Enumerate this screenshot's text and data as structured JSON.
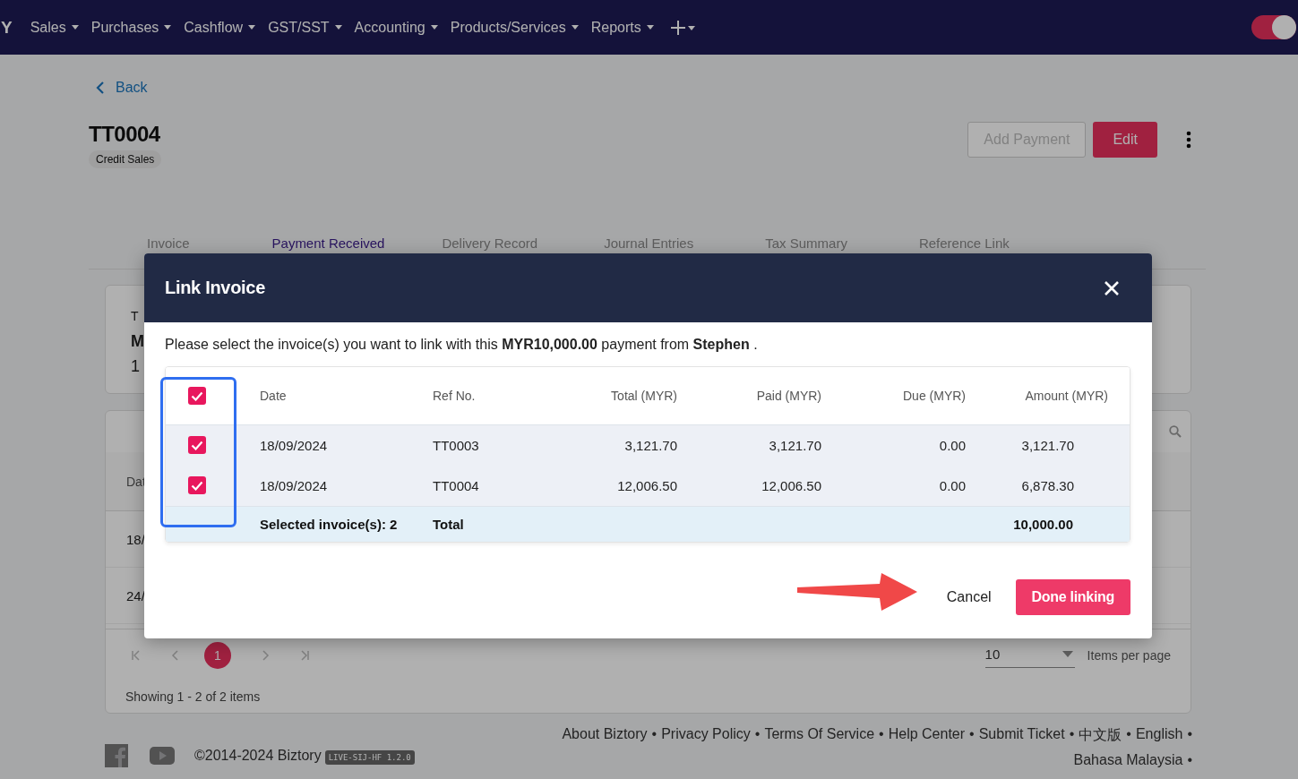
{
  "nav": {
    "logo": "Y",
    "items": [
      {
        "label": "Sales"
      },
      {
        "label": "Purchases"
      },
      {
        "label": "Cashflow"
      },
      {
        "label": "GST/SST"
      },
      {
        "label": "Accounting"
      },
      {
        "label": "Products/Services"
      },
      {
        "label": "Reports"
      }
    ],
    "theme_toggle": {
      "on": true
    }
  },
  "back": "Back",
  "document": {
    "number": "TT0004",
    "badge": "Credit Sales"
  },
  "actions": [
    {
      "label": "Add Payment",
      "kind": "outline"
    },
    {
      "label": "Edit",
      "kind": "primary"
    }
  ],
  "tabs": [
    {
      "label": "Invoice",
      "selected": false
    },
    {
      "label": "Payment Received",
      "selected": true
    },
    {
      "label": "Delivery Record",
      "selected": false
    },
    {
      "label": "Journal Entries",
      "selected": false
    },
    {
      "label": "Tax Summary",
      "selected": false
    },
    {
      "label": "Reference Link",
      "selected": false
    }
  ],
  "summary_card": {
    "lines": [
      "T",
      "M",
      "1"
    ]
  },
  "list_card": {
    "column_1": "Dat",
    "rows": [
      "18/",
      "24/"
    ],
    "pages": [
      {
        "label": "1",
        "selected": true
      }
    ],
    "page_size": "10",
    "page_size_label": "Items per page",
    "showing": "Showing 1 - 2 of 2 items"
  },
  "footer": {
    "copyright": "©2014-2024 Biztory",
    "version": "LIVE-SIJ-HF 1.2.0",
    "separator": "•",
    "links": [
      "About Biztory",
      "Privacy Policy",
      "Terms Of Service",
      "Help Center",
      "Submit Ticket",
      "中文版",
      "English",
      "Bahasa Malaysia"
    ]
  },
  "dialog": {
    "title": "Link Invoice",
    "message": "Please select the invoice(s) you want to link with this **MYR10,000.00** payment from **Stephen** .",
    "select_all": {
      "checked": true
    },
    "columns": [
      "Date",
      "Ref No.",
      "Total (MYR)",
      "Paid (MYR)",
      "Due (MYR)",
      "Amount (MYR)"
    ],
    "rows": [
      {
        "checked": true,
        "date": "18/09/2024",
        "ref": "TT0003",
        "total": "3,121.70",
        "paid": "3,121.70",
        "due": "0.00",
        "amount": "3,121.70"
      },
      {
        "checked": true,
        "date": "18/09/2024",
        "ref": "TT0004",
        "total": "12,006.50",
        "paid": "12,006.50",
        "due": "0.00",
        "amount": "6,878.30"
      }
    ],
    "summary": {
      "selected": "Selected invoice(s): 2",
      "label": "Total",
      "amount": "10,000.00"
    },
    "buttons": [
      {
        "label": "Cancel",
        "kind": "text"
      },
      {
        "label": "Done linking",
        "kind": "primary"
      }
    ]
  }
}
